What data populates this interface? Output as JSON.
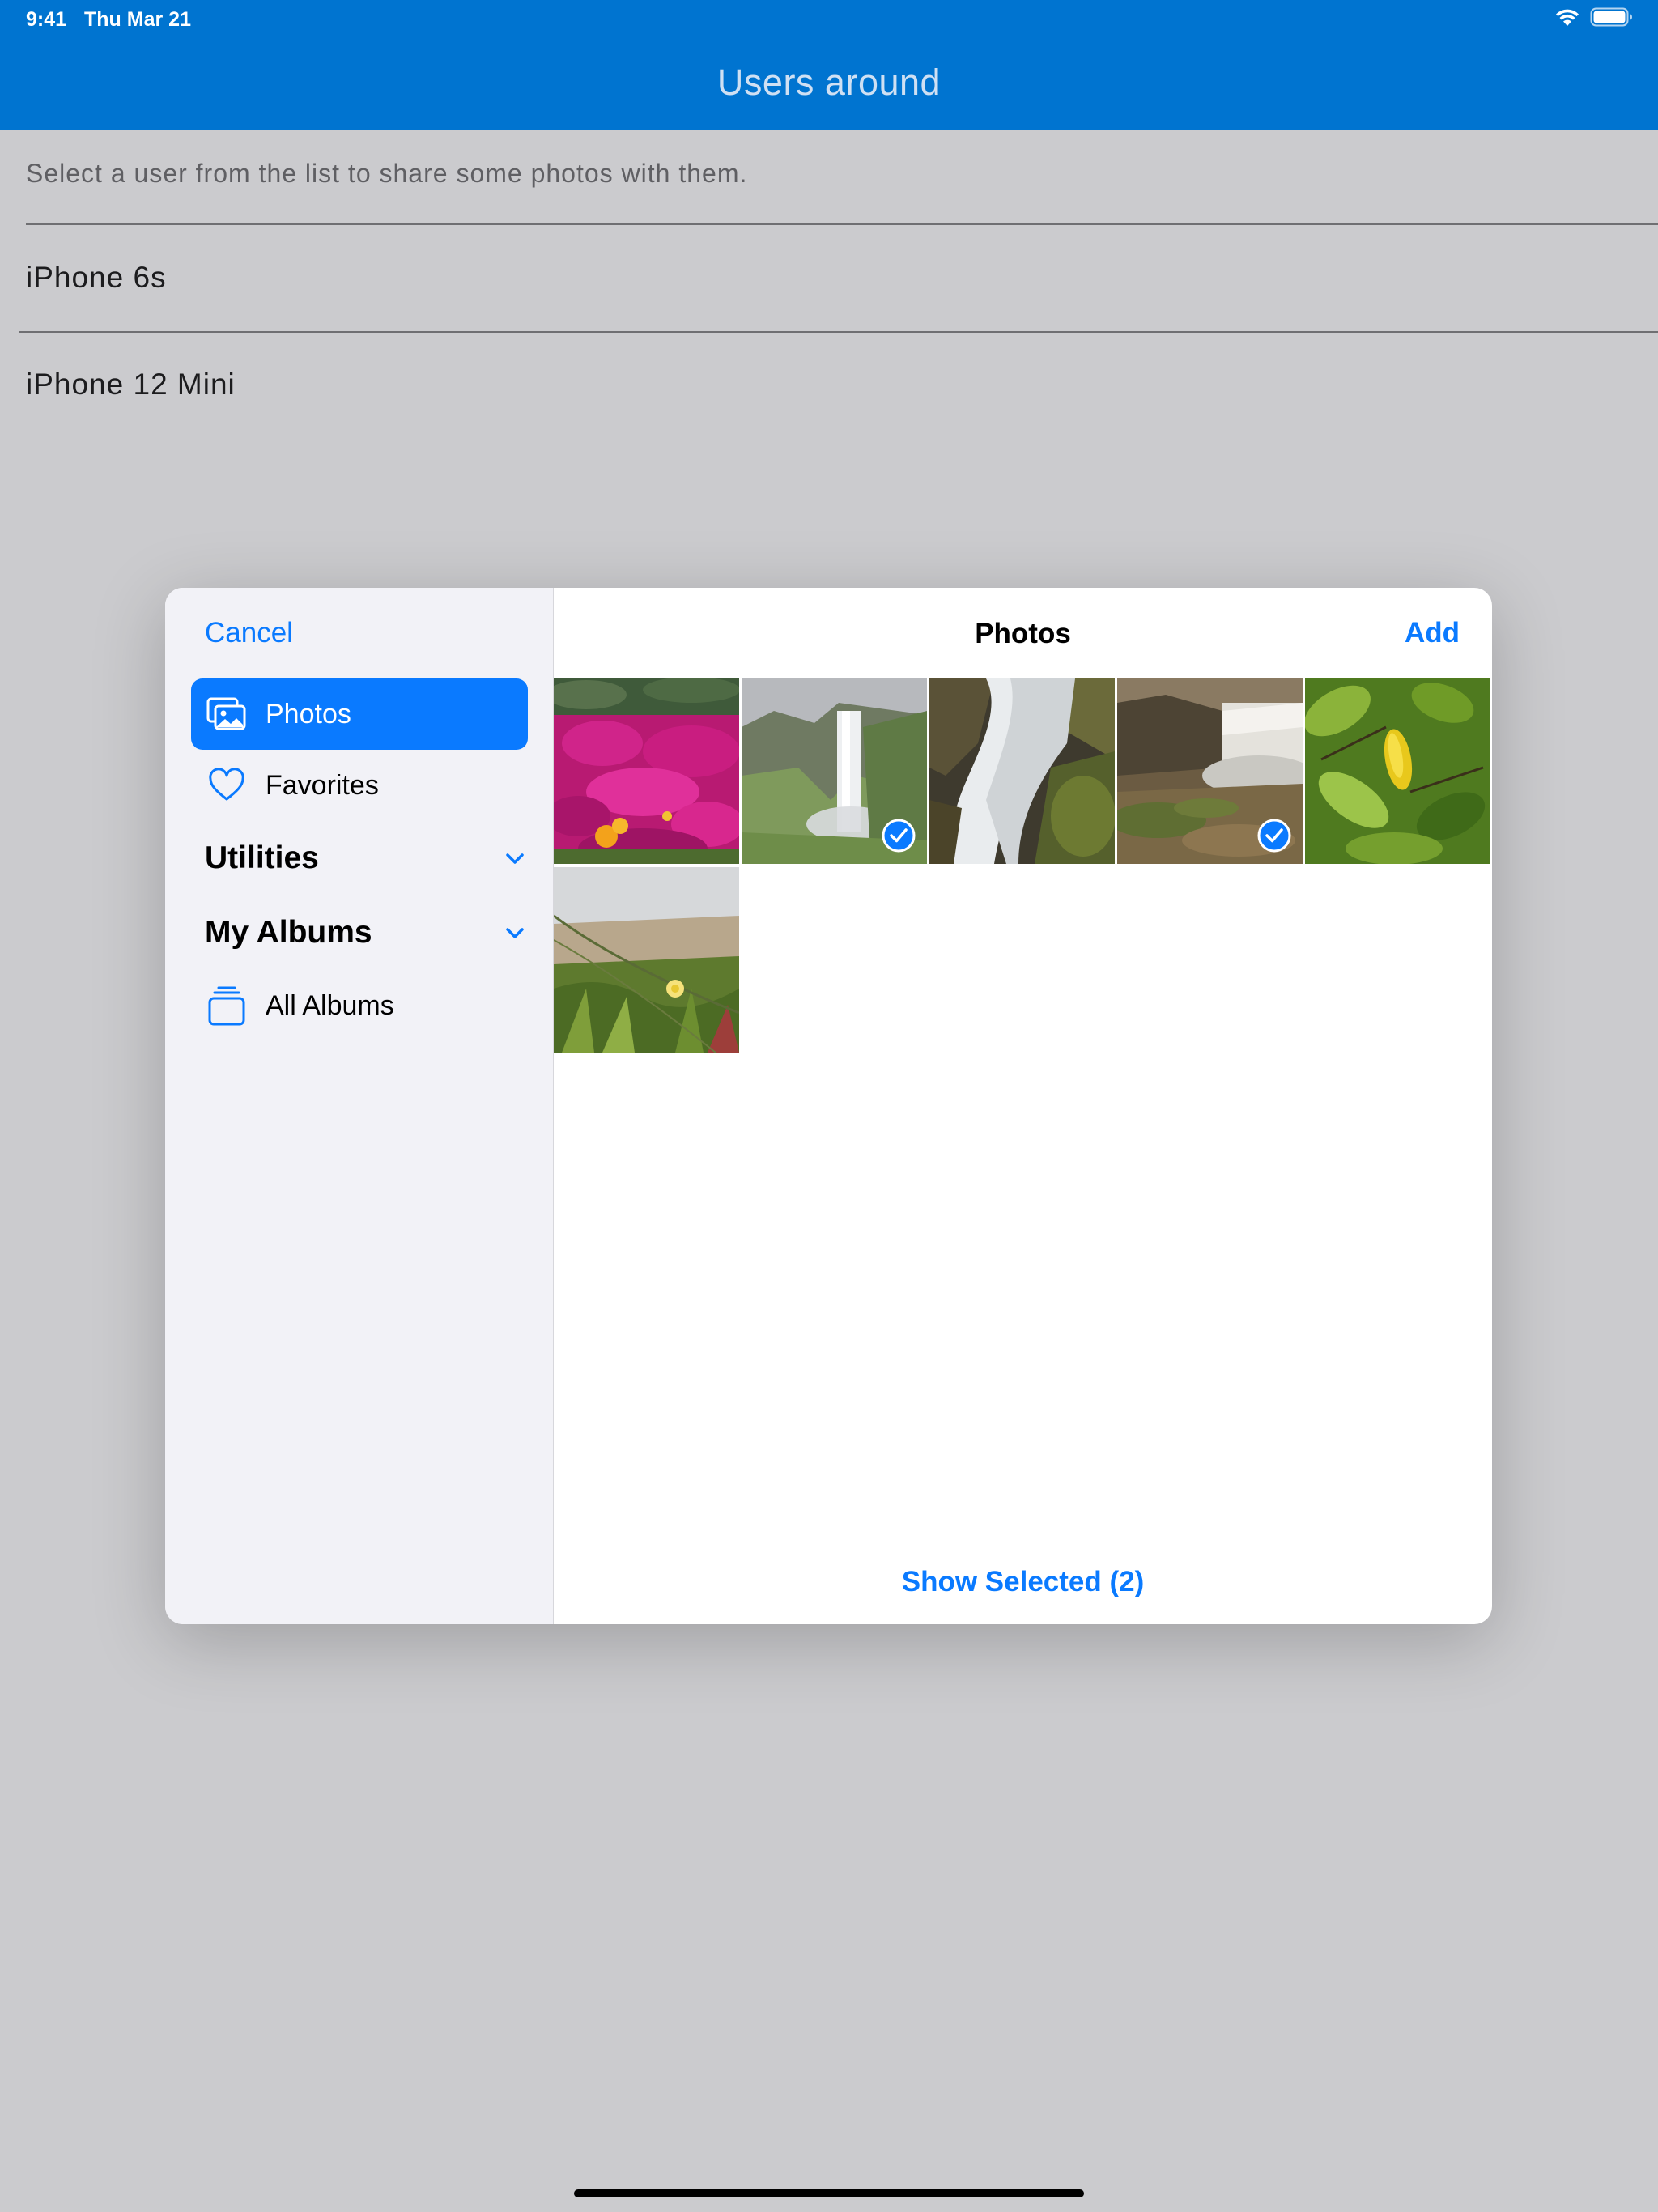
{
  "status_bar": {
    "time": "9:41",
    "date": "Thu Mar 21",
    "icons": [
      "wifi-icon",
      "battery-icon"
    ]
  },
  "app": {
    "title": "Users around",
    "instruction": "Select a user from the list to share some photos with them.",
    "users": [
      "iPhone 6s",
      "iPhone 12 Mini"
    ]
  },
  "picker": {
    "cancel_label": "Cancel",
    "title": "Photos",
    "add_label": "Add",
    "sidebar": {
      "items": [
        {
          "label": "Photos",
          "icon": "photos-icon",
          "selected": true
        },
        {
          "label": "Favorites",
          "icon": "heart-icon",
          "selected": false
        }
      ],
      "sections": [
        {
          "label": "Utilities",
          "icon": "chevron-down-icon"
        },
        {
          "label": "My Albums",
          "icon": "chevron-down-icon"
        }
      ],
      "albums_item": {
        "label": "All Albums",
        "icon": "albums-stack-icon"
      }
    },
    "photos": [
      {
        "subject": "pink-flowers",
        "selected": false
      },
      {
        "subject": "waterfall-mist",
        "selected": true
      },
      {
        "subject": "waterfall-rocks",
        "selected": false
      },
      {
        "subject": "waterfall-valley",
        "selected": true
      },
      {
        "subject": "lemon-leaves",
        "selected": false
      },
      {
        "subject": "dune-grass",
        "selected": false
      }
    ],
    "show_selected_label": "Show Selected (2)"
  },
  "colors": {
    "accent": "#0a7aff",
    "header_bar": "#0074d0",
    "backdrop": "#cbcbce",
    "sidebar_bg": "#f2f2f7"
  }
}
